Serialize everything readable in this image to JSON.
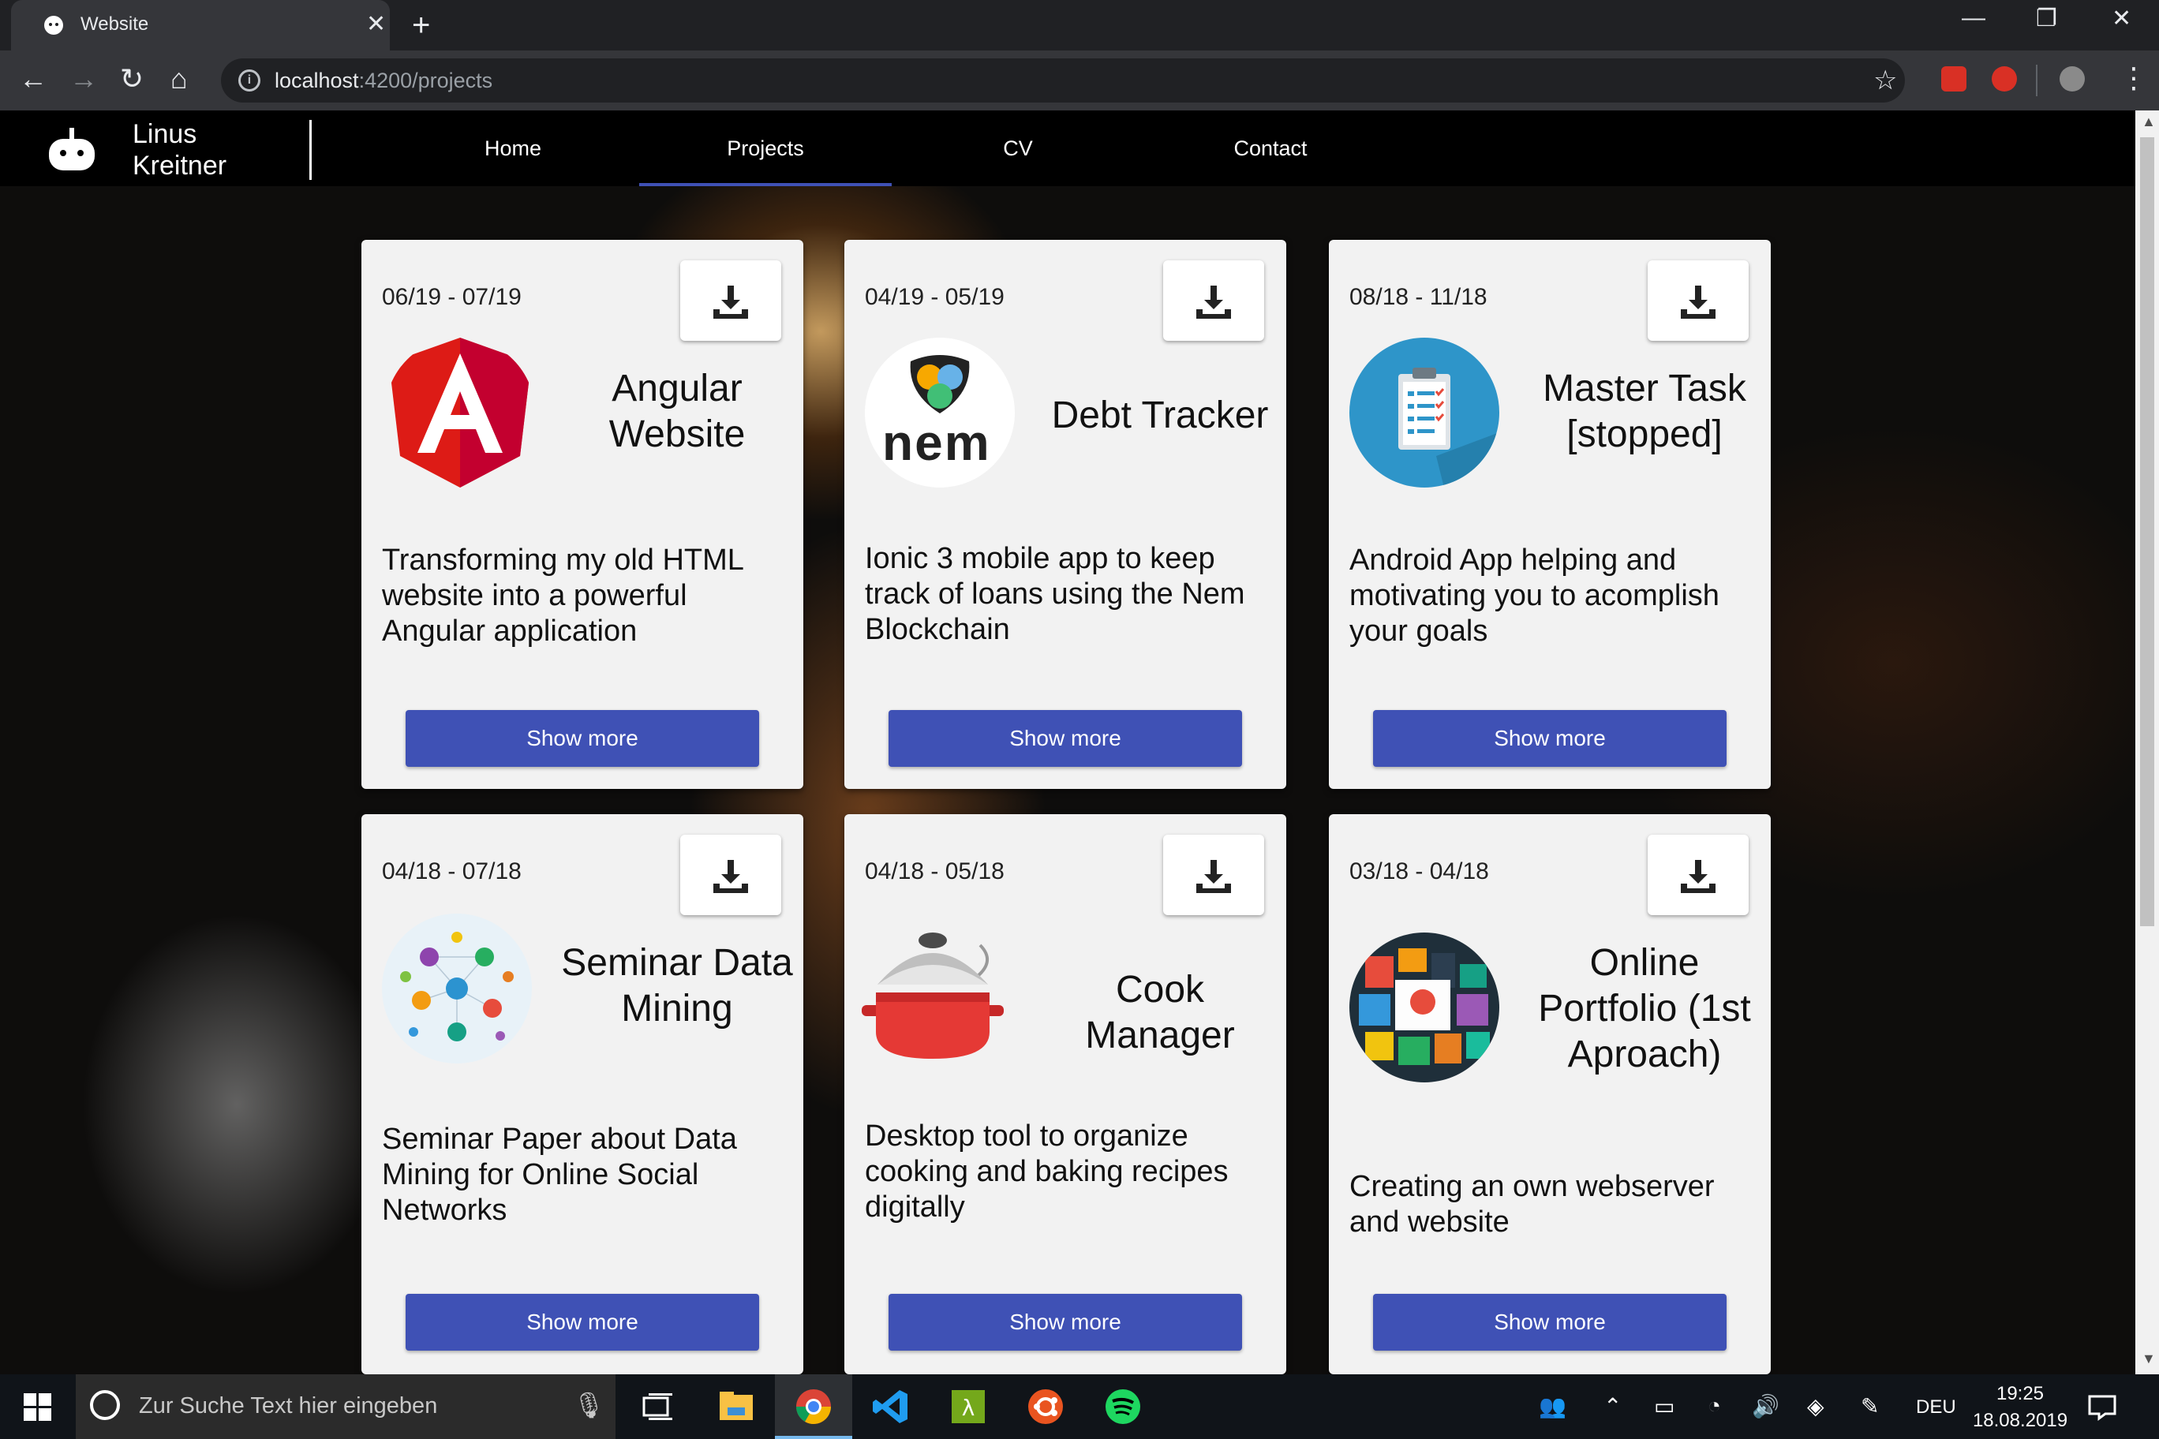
{
  "browser": {
    "tab_title": "Website",
    "tab_close": "✕",
    "new_tab": "+",
    "url_host": "localhost",
    "url_rest": ":4200/projects",
    "star": "☆",
    "menu": "⋮",
    "window": {
      "minimize": "—",
      "restore": "❐",
      "close": "✕"
    }
  },
  "app": {
    "brand_line1": "Linus",
    "brand_line2": "Kreitner",
    "nav": [
      {
        "label": "Home"
      },
      {
        "label": "Projects"
      },
      {
        "label": "CV"
      },
      {
        "label": "Contact"
      }
    ],
    "active_nav": "Projects"
  },
  "projects": [
    {
      "date": "06/19 - 07/19",
      "title": "Angular Website",
      "icon": "angular-logo",
      "description": "Transforming my old HTML website into a powerful Angular application",
      "button": "Show more"
    },
    {
      "date": "04/19 - 05/19",
      "title": "Debt Tracker",
      "icon": "nem-logo",
      "icon_text": "nem",
      "description": "Ionic 3 mobile app to keep track of loans using the Nem Blockchain",
      "button": "Show more"
    },
    {
      "date": "08/18 - 11/18",
      "title": "Master Task [stopped]",
      "icon": "clipboard-checklist",
      "description": "Android App helping and motivating you to acomplish your goals",
      "button": "Show more"
    },
    {
      "date": "04/18 - 07/18",
      "title": "Seminar Data Mining",
      "icon": "network-graph",
      "description": "Seminar Paper about Data Mining for Online Social Networks",
      "button": "Show more"
    },
    {
      "date": "04/18 - 05/18",
      "title": "Cook Manager",
      "icon": "cooking-pot",
      "description": "Desktop tool to organize cooking and baking recipes digitally",
      "button": "Show more"
    },
    {
      "date": "03/18 - 04/18",
      "title": "Online Portfolio (1st Aproach)",
      "icon": "web-portfolio-grid",
      "description": "Creating an own webserver and website",
      "button": "Show more"
    }
  ],
  "taskbar": {
    "search_placeholder": "Zur Suche Text hier eingeben",
    "language": "DEU",
    "time": "19:25",
    "date": "18.08.2019",
    "apps": [
      "task-view",
      "file-explorer",
      "chrome",
      "vscode",
      "terminal",
      "ubuntu",
      "spotify"
    ]
  },
  "colors": {
    "primary": "#3f51b5",
    "card_bg": "#f2f2f2",
    "toolbar": "#35363a",
    "tabbar": "#202124"
  }
}
